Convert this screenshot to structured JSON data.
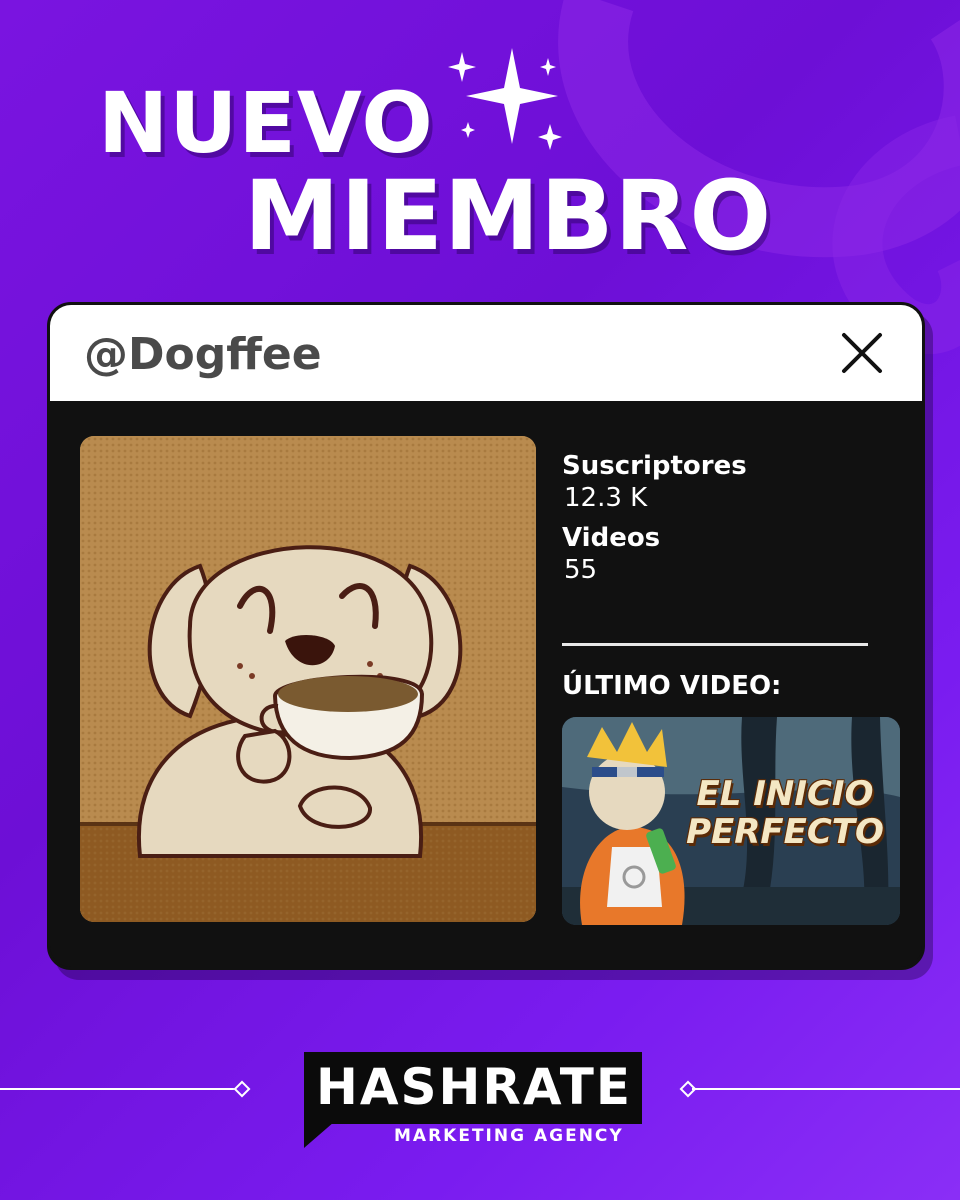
{
  "headline": {
    "line1": "NUEVO",
    "line2": "MIEMBRO"
  },
  "profile": {
    "handle": "@Dogffee",
    "stats": [
      {
        "label": "Suscriptores",
        "value": "12.3 K"
      },
      {
        "label": "Videos",
        "value": "55"
      }
    ],
    "last_video_label": "ÚLTIMO VIDEO:",
    "last_video_title": "EL INICIO PERFECTO"
  },
  "brand": {
    "name": "HASHRATE",
    "subtitle": "MARKETING AGENCY"
  },
  "icons": {
    "close": "close-icon",
    "sparkles": "sparkles-icon"
  },
  "colors": {
    "background": "#7a14e0",
    "card": "#111111",
    "header": "#ffffff"
  }
}
